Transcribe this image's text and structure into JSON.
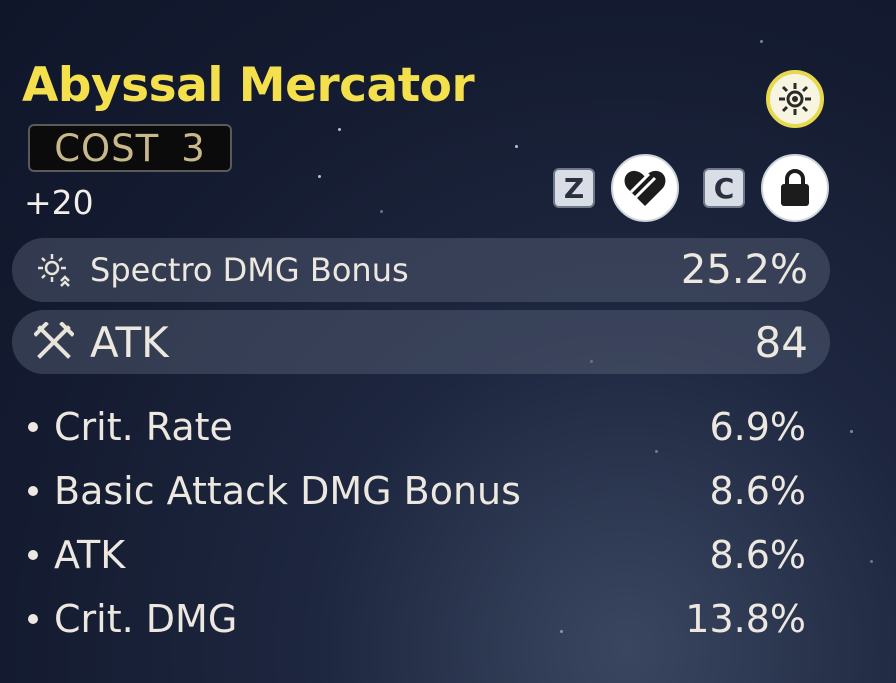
{
  "echo": {
    "name": "Abyssal Mercator",
    "cost_label": "COST",
    "cost_value": "3",
    "level": "+20",
    "element_icon": "spectro-sun-icon",
    "accent_color": "#f4e04d"
  },
  "actions": {
    "discard_key": "Z",
    "discard_icon": "discard-heart-icon",
    "lock_key": "C",
    "lock_icon": "lock-icon"
  },
  "main_stats": [
    {
      "name": "Spectro DMG Bonus",
      "value": "25.2%",
      "icon": "spectro-dmg-icon"
    },
    {
      "name": "ATK",
      "value": "84",
      "icon": "crossed-swords-icon"
    }
  ],
  "sub_stats": [
    {
      "name": "Crit. Rate",
      "value": "6.9%"
    },
    {
      "name": "Basic Attack DMG Bonus",
      "value": "8.6%"
    },
    {
      "name": "ATK",
      "value": "8.6%"
    },
    {
      "name": "Crit. DMG",
      "value": "13.8%"
    }
  ]
}
